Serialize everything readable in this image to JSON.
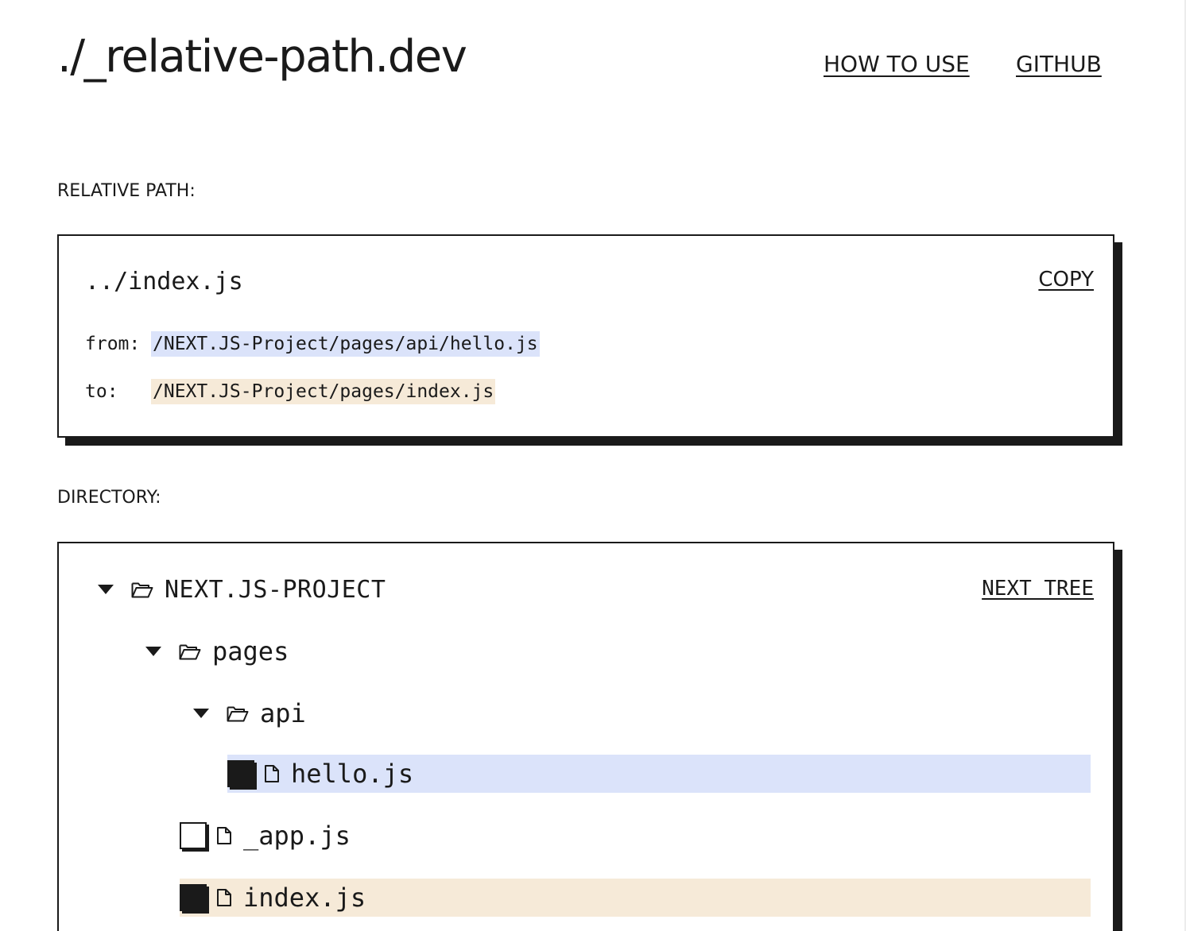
{
  "header": {
    "title": "./_relative-path.dev",
    "nav": [
      {
        "label": "HOW TO USE"
      },
      {
        "label": "GITHUB"
      }
    ]
  },
  "relative_path": {
    "section_label": "RELATIVE PATH:",
    "result": "../index.js",
    "copy_label": "COPY",
    "from_label": "from:",
    "from_path": "/NEXT.JS-Project/pages/api/hello.js",
    "to_label": "to:",
    "to_path": "/NEXT.JS-Project/pages/index.js",
    "from_color": "#dbe3fa",
    "to_color": "#f6ead8"
  },
  "directory": {
    "section_label": "DIRECTORY:",
    "next_tree_label": "NEXT TREE",
    "tree": [
      {
        "type": "folder",
        "name": "NEXT.JS-PROJECT",
        "expanded": true,
        "icon": "folder-open-icon"
      },
      {
        "type": "folder",
        "name": "pages",
        "expanded": true,
        "icon": "folder-open-icon"
      },
      {
        "type": "folder",
        "name": "api",
        "expanded": true,
        "icon": "folder-open-icon"
      },
      {
        "type": "file",
        "name": "hello.js",
        "checked": true,
        "selection": "from",
        "icon": "file-icon"
      },
      {
        "type": "file",
        "name": "_app.js",
        "checked": false,
        "selection": "none",
        "icon": "file-icon"
      },
      {
        "type": "file",
        "name": "index.js",
        "checked": true,
        "selection": "to",
        "icon": "file-icon"
      }
    ]
  }
}
